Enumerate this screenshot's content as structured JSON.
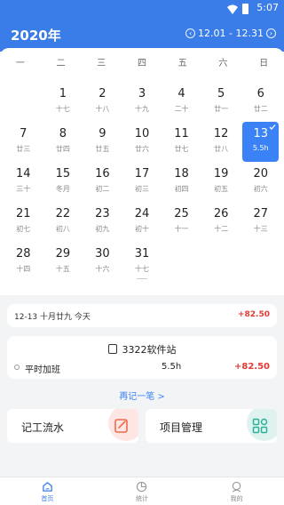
{
  "status": {
    "time": "5:07"
  },
  "header": {
    "year": "2020年",
    "range": "12.01 - 12.31"
  },
  "weekdays": [
    "一",
    "二",
    "三",
    "四",
    "五",
    "六",
    "日"
  ],
  "calendar": {
    "days": [
      {
        "d": "",
        "l": ""
      },
      {
        "d": "1",
        "l": "十七"
      },
      {
        "d": "2",
        "l": "十八"
      },
      {
        "d": "3",
        "l": "十九"
      },
      {
        "d": "4",
        "l": "二十"
      },
      {
        "d": "5",
        "l": "廿一"
      },
      {
        "d": "6",
        "l": "廿二"
      },
      {
        "d": "7",
        "l": "廿三"
      },
      {
        "d": "8",
        "l": "廿四"
      },
      {
        "d": "9",
        "l": "廿五"
      },
      {
        "d": "10",
        "l": "廿六"
      },
      {
        "d": "11",
        "l": "廿七"
      },
      {
        "d": "12",
        "l": "廿八"
      },
      {
        "d": "13",
        "l": "5.5h",
        "selected": true
      },
      {
        "d": "14",
        "l": "三十"
      },
      {
        "d": "15",
        "l": "冬月"
      },
      {
        "d": "16",
        "l": "初二"
      },
      {
        "d": "17",
        "l": "初三"
      },
      {
        "d": "18",
        "l": "初四"
      },
      {
        "d": "19",
        "l": "初五"
      },
      {
        "d": "20",
        "l": "初六"
      },
      {
        "d": "21",
        "l": "初七"
      },
      {
        "d": "22",
        "l": "初八"
      },
      {
        "d": "23",
        "l": "初九"
      },
      {
        "d": "24",
        "l": "初十"
      },
      {
        "d": "25",
        "l": "十一"
      },
      {
        "d": "26",
        "l": "十二"
      },
      {
        "d": "27",
        "l": "十三"
      },
      {
        "d": "28",
        "l": "十四"
      },
      {
        "d": "29",
        "l": "十五"
      },
      {
        "d": "30",
        "l": "十六"
      },
      {
        "d": "31",
        "l": "十七"
      }
    ]
  },
  "summary": {
    "date": "12-13  十月廿九  今天",
    "amount": "+82.50"
  },
  "site": {
    "title": "3322软件站",
    "item_name": "平时加班",
    "hours": "5.5h",
    "amount": "+82.50"
  },
  "again_label": "再记一笔 >",
  "tiles": {
    "left": "记工流水",
    "right": "项目管理"
  },
  "tabs": [
    {
      "label": "首页"
    },
    {
      "label": "统计"
    },
    {
      "label": "我的"
    }
  ],
  "colors": {
    "primary": "#3b7de8",
    "selected": "#3b82f6",
    "income": "#e53935"
  }
}
